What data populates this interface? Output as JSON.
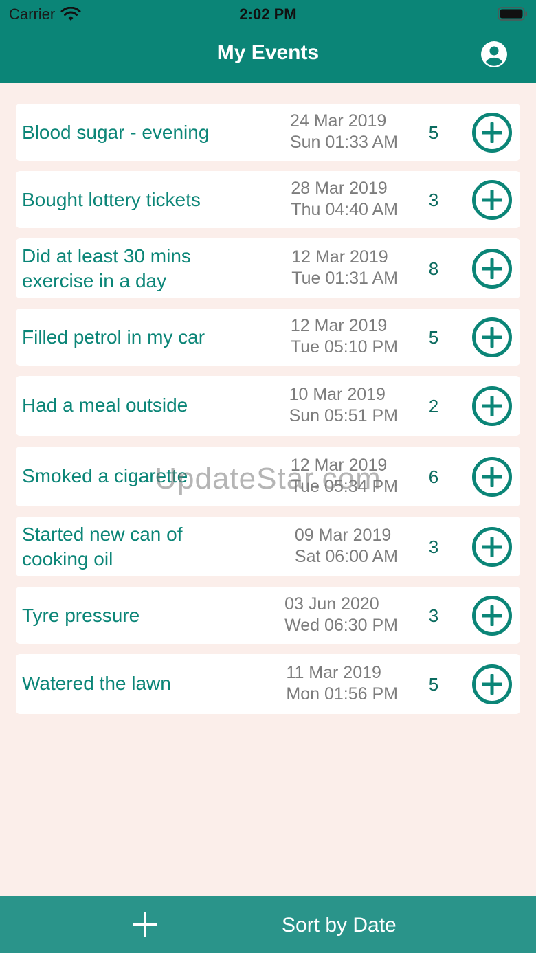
{
  "status_bar": {
    "carrier": "Carrier",
    "time": "2:02 PM"
  },
  "nav": {
    "title": "My Events",
    "profile_icon": "person-circle-icon"
  },
  "events": [
    {
      "title": "Blood sugar - evening",
      "date": "24 Mar 2019",
      "day_time": "Sun 01:33 AM",
      "count": "5"
    },
    {
      "title": "Bought lottery tickets",
      "date": "28 Mar 2019",
      "day_time": "Thu 04:40 AM",
      "count": "3"
    },
    {
      "title": "Did at least 30 mins exercise in a day",
      "date": "12 Mar 2019",
      "day_time": "Tue 01:31 AM",
      "count": "8"
    },
    {
      "title": "Filled petrol in my car",
      "date": "12 Mar 2019",
      "day_time": "Tue 05:10 PM",
      "count": "5"
    },
    {
      "title": "Had a meal outside",
      "date": "10 Mar 2019",
      "day_time": "Sun 05:51 PM",
      "count": "2"
    },
    {
      "title": "Smoked a cigarette",
      "date": "12 Mar 2019",
      "day_time": "Tue 05:34 PM",
      "count": "6"
    },
    {
      "title": "Started new can of cooking oil",
      "date": "09 Mar 2019",
      "day_time": "Sat 06:00 AM",
      "count": "3"
    },
    {
      "title": "Tyre pressure",
      "date": "03 Jun 2020",
      "day_time": "Wed 06:30 PM",
      "count": "3"
    },
    {
      "title": "Watered the lawn",
      "date": "11 Mar 2019",
      "day_time": "Mon 01:56 PM",
      "count": "5"
    }
  ],
  "watermark": "UpdateStar.com",
  "toolbar": {
    "add_icon": "plus-icon",
    "sort_label": "Sort by Date"
  },
  "colors": {
    "primary": "#0b8577",
    "toolbar": "#2a948a",
    "background": "#fbeeea",
    "card": "#ffffff",
    "date_text": "#7d7d7d"
  }
}
